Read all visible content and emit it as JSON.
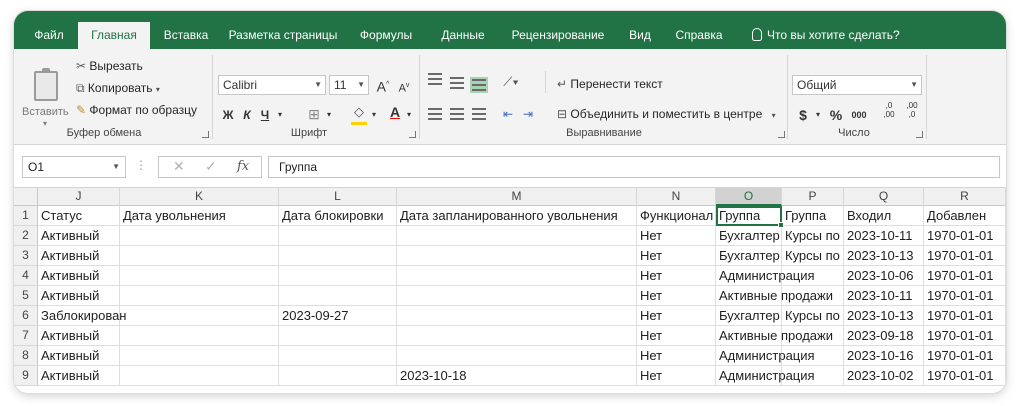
{
  "tabs": [
    "Файл",
    "Главная",
    "Вставка",
    "Разметка страницы",
    "Формулы",
    "Данные",
    "Рецензирование",
    "Вид",
    "Справка"
  ],
  "tell_me": "Что вы хотите сделать?",
  "clipboard": {
    "paste": "Вставить",
    "cut": "Вырезать",
    "copy": "Копировать",
    "format_painter": "Формат по образцу",
    "label": "Буфер обмена"
  },
  "font": {
    "name": "Calibri",
    "size": "11",
    "grow": "A",
    "shrink": "A",
    "bold": "Ж",
    "italic": "К",
    "underline": "Ч",
    "font_color": "A",
    "label": "Шрифт"
  },
  "alignment": {
    "wrap": "Перенести текст",
    "merge": "Объединить и поместить в центре",
    "label": "Выравнивание"
  },
  "number": {
    "format": "Общий",
    "currency": "$",
    "percent": "%",
    "thousands": "000",
    "inc_dec": ",0\n,00",
    "dec_dec": ",00\n,0",
    "label": "Число"
  },
  "formula_bar": {
    "name_box": "O1",
    "fx": "fx",
    "value": "Группа"
  },
  "columns": [
    "J",
    "K",
    "L",
    "M",
    "N",
    "O",
    "P",
    "Q",
    "R"
  ],
  "rows": [
    {
      "num": "1",
      "cells": [
        "Статус",
        "Дата увольнения",
        "Дата блокировки",
        "Дата запланированного увольнения",
        "Функционал",
        "Группа",
        "Группа",
        "Входил",
        "Добавлен"
      ]
    },
    {
      "num": "2",
      "cells": [
        "Активный",
        "",
        "",
        "",
        "Нет",
        "Бухгалтер",
        "Курсы по",
        "2023-10-11",
        "1970-01-01"
      ]
    },
    {
      "num": "3",
      "cells": [
        "Активный",
        "",
        "",
        "",
        "Нет",
        "Бухгалтер",
        "Курсы по",
        "2023-10-13",
        "1970-01-01"
      ]
    },
    {
      "num": "4",
      "cells": [
        "Активный",
        "",
        "",
        "",
        "Нет",
        "Администрация",
        "",
        "2023-10-06",
        "1970-01-01"
      ]
    },
    {
      "num": "5",
      "cells": [
        "Активный",
        "",
        "",
        "",
        "Нет",
        "Активные продажи",
        "",
        "2023-10-11",
        "1970-01-01"
      ]
    },
    {
      "num": "6",
      "cells": [
        "Заблокирован",
        "",
        "2023-09-27",
        "",
        "Нет",
        "Бухгалтер",
        "Курсы по",
        "2023-10-13",
        "1970-01-01"
      ]
    },
    {
      "num": "7",
      "cells": [
        "Активный",
        "",
        "",
        "",
        "Нет",
        "Активные продажи",
        "",
        "2023-09-18",
        "1970-01-01"
      ]
    },
    {
      "num": "8",
      "cells": [
        "Активный",
        "",
        "",
        "",
        "Нет",
        "Администрация",
        "",
        "2023-10-16",
        "1970-01-01"
      ]
    },
    {
      "num": "9",
      "cells": [
        "Активный",
        "",
        "",
        "2023-10-18",
        "Нет",
        "Администрация",
        "",
        "2023-10-02",
        "1970-01-01"
      ]
    }
  ],
  "colors": {
    "brand": "#217346",
    "selection": "#217346"
  }
}
